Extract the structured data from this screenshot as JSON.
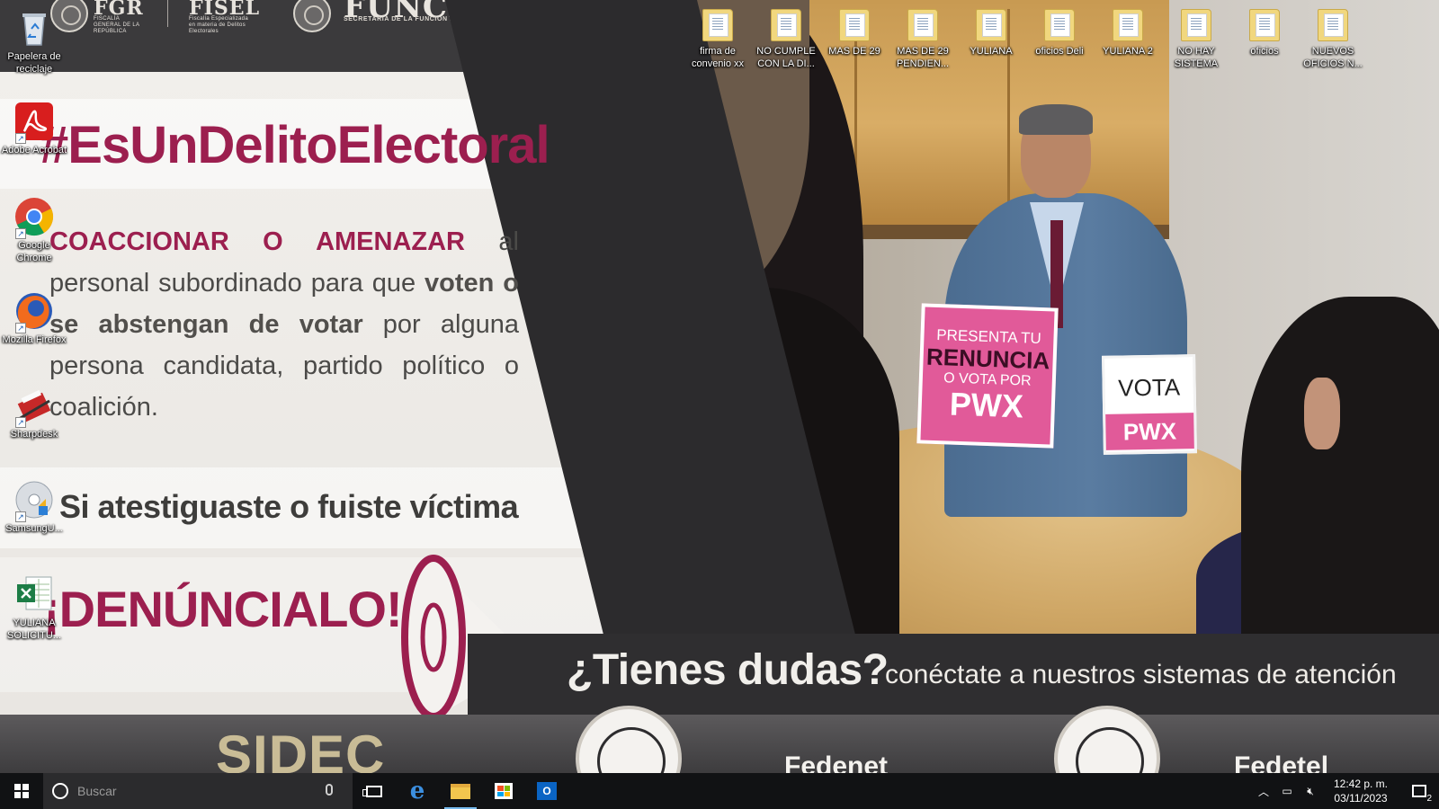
{
  "wallpaper": {
    "logos": {
      "fgr_big": "FGR",
      "fgr_small": "FISCALÍA GENERAL DE LA REPÚBLICA",
      "fisel_big": "FISEL",
      "fisel_small": "Fiscalía Especializada en materia de Delitos Electorales",
      "ff_title": "FUNCIÓN PÚBLICA",
      "ff_sub": "SECRETARÍA DE LA FUNCIÓN PÚBLICA"
    },
    "hashtag": "#EsUnDelitoElectoral",
    "body": {
      "strong_red": "COACCIONAR O AMENAZAR",
      "t1": " al personal subordinado para que ",
      "strong": "voten o se abstengan de votar",
      "t2": " por alguna persona candidata, partido político o coalición."
    },
    "witness": "Si atestiguaste o fuiste víctima",
    "denuncia": "¡DENÚNCIALO!",
    "sign1": {
      "l1": "PRESENTA TU",
      "l2": "RENUNCIA",
      "l3": "O VOTA POR",
      "l4": "PWX"
    },
    "sign2": {
      "l1": "VOTA",
      "l2": "PWX"
    },
    "tienes": "¿Tienes dudas?",
    "conectate": "conéctate a nuestros sistemas de atención",
    "sidec": "SIDEC",
    "badge1": "Fedenet",
    "badge2": "Fedetel"
  },
  "desktop_icons": [
    {
      "label": "Papelera de reciclaje",
      "icon": "recycle-bin-icon"
    },
    {
      "label": "Adobe Acrobat",
      "icon": "adobe-acrobat-icon"
    },
    {
      "label": "Google Chrome",
      "icon": "chrome-icon"
    },
    {
      "label": "Mozilla Firefox",
      "icon": "firefox-icon"
    },
    {
      "label": "Sharpdesk",
      "icon": "sharpdesk-icon"
    },
    {
      "label": "SamsungU...",
      "icon": "samsung-disc-icon"
    },
    {
      "label": "YULIANA SOLICITU...",
      "icon": "excel-file-icon"
    }
  ],
  "folders": [
    {
      "label": "firma de convenio xx"
    },
    {
      "label": "NO CUMPLE CON LA DI..."
    },
    {
      "label": "MAS DE 29"
    },
    {
      "label": "MAS DE 29 PENDIEN..."
    },
    {
      "label": "YULIANA"
    },
    {
      "label": "oficios Deli"
    },
    {
      "label": "YULIANA 2"
    },
    {
      "label": "NO HAY SISTEMA"
    },
    {
      "label": "oficios"
    },
    {
      "label": "NUEVOS OFICIOS N..."
    }
  ],
  "taskbar": {
    "search_placeholder": "Buscar",
    "outlook_letter": "O",
    "edge_letter": "e",
    "time": "12:42 p. m.",
    "date": "03/11/2023",
    "notif_count": "2"
  },
  "colors": {
    "accent": "#9c1f4f",
    "pink_sign": "#e15a99",
    "taskbar": "#111214"
  }
}
